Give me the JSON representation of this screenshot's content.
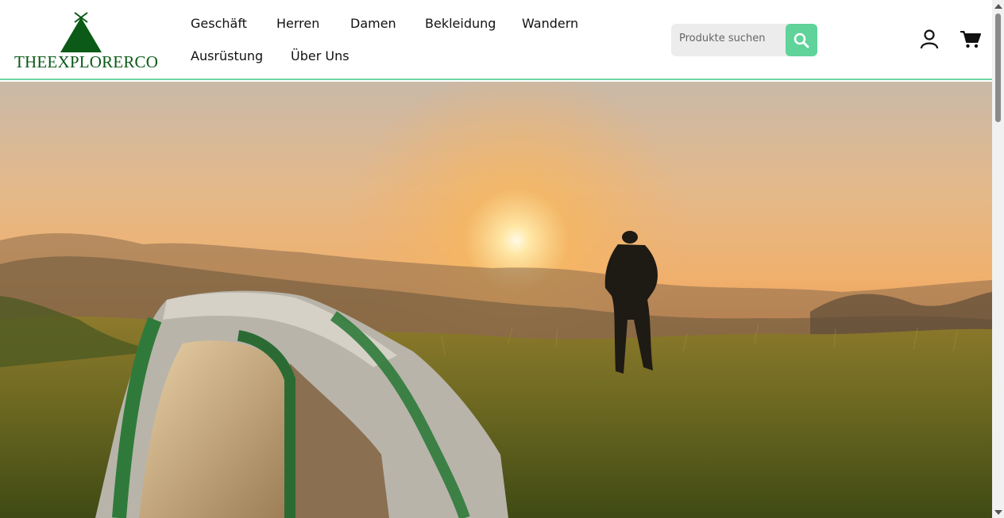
{
  "brand": {
    "name": "THEEXPLORERCO",
    "color": "#0b5a17"
  },
  "nav": {
    "items": [
      {
        "label": "Geschäft"
      },
      {
        "label": "Herren"
      },
      {
        "label": "Damen"
      },
      {
        "label": "Bekleidung"
      },
      {
        "label": "Wandern"
      },
      {
        "label": "Ausrüstung"
      },
      {
        "label": "Über Uns"
      }
    ]
  },
  "search": {
    "placeholder": "Produkte suchen",
    "button_icon": "search-icon",
    "accent": "#5fd39a"
  },
  "header_icons": {
    "account": "user-icon",
    "cart": "cart-icon"
  },
  "hero": {
    "image": "sunrise-camping-scene"
  }
}
